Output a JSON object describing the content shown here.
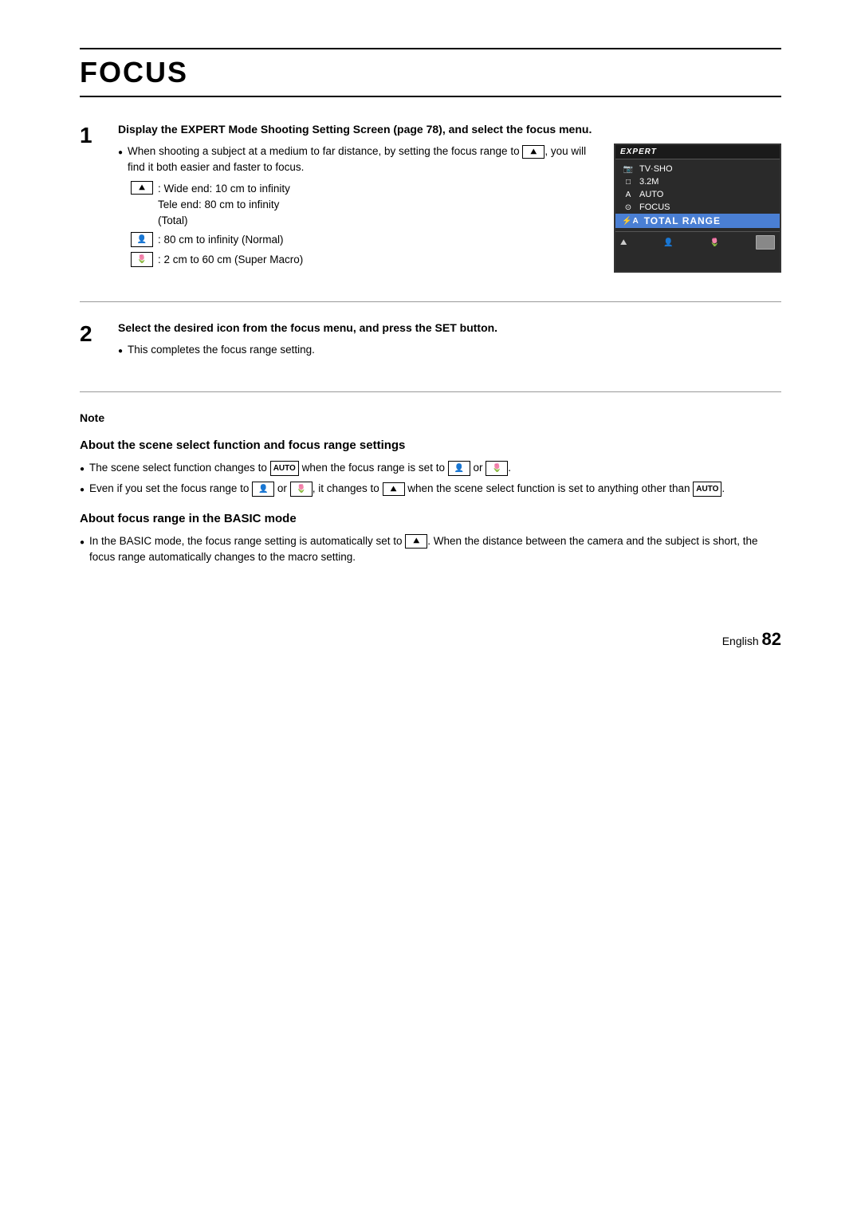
{
  "page": {
    "title": "FOCUS",
    "footer_text": "English",
    "page_number": "82"
  },
  "step1": {
    "number": "1",
    "title": "Display the EXPERT Mode Shooting Setting Screen (page 78), and select the focus menu.",
    "bullets": [
      {
        "text": "When shooting a subject at a medium to far distance, by setting the focus range to [icon:landscape], you will find it both easier and faster to focus."
      }
    ],
    "indent_items": [
      {
        "icon_label": "landscape",
        "text": ": Wide end: 10 cm to infinity\nTele end: 80 cm to infinity\n(Total)"
      },
      {
        "icon_label": "normal",
        "text": ": 80 cm to infinity (Normal)"
      },
      {
        "icon_label": "macro",
        "text": ": 2 cm to 60 cm (Super Macro)"
      }
    ]
  },
  "camera_screen": {
    "header": "EXPERT",
    "rows": [
      {
        "icon": "TV·SHO",
        "label": "",
        "highlighted": false
      },
      {
        "icon": "3.2M",
        "label": "",
        "highlighted": false
      },
      {
        "icon": "AUTO",
        "label": "",
        "highlighted": false
      },
      {
        "icon": "●",
        "label": "FOCUS",
        "highlighted": false
      },
      {
        "icon": "⚡A",
        "label": "TOTAL RANGE",
        "highlighted": true
      }
    ],
    "footer_icons": [
      "landscape-icon",
      "normal-icon",
      "macro-icon"
    ]
  },
  "step2": {
    "number": "2",
    "title": "Select the desired icon from the focus menu, and press the SET button.",
    "bullets": [
      "This completes the focus range setting."
    ]
  },
  "note": {
    "label": "Note",
    "subsection1_title": "About the scene select function and focus range settings",
    "subsection1_bullets": [
      "The scene select function changes to [AUTO] when the focus range is set to [normal] or [macro].",
      "Even if you set the focus range to [normal] or [macro], it changes to [landscape] when the scene select function is set to anything other than [AUTO]."
    ],
    "subsection2_title": "About focus range in the BASIC mode",
    "subsection2_bullets": [
      "In the BASIC mode, the focus range setting is automatically set to [landscape]. When the distance between the camera and the subject is short, the focus range automatically changes to the macro setting."
    ]
  }
}
